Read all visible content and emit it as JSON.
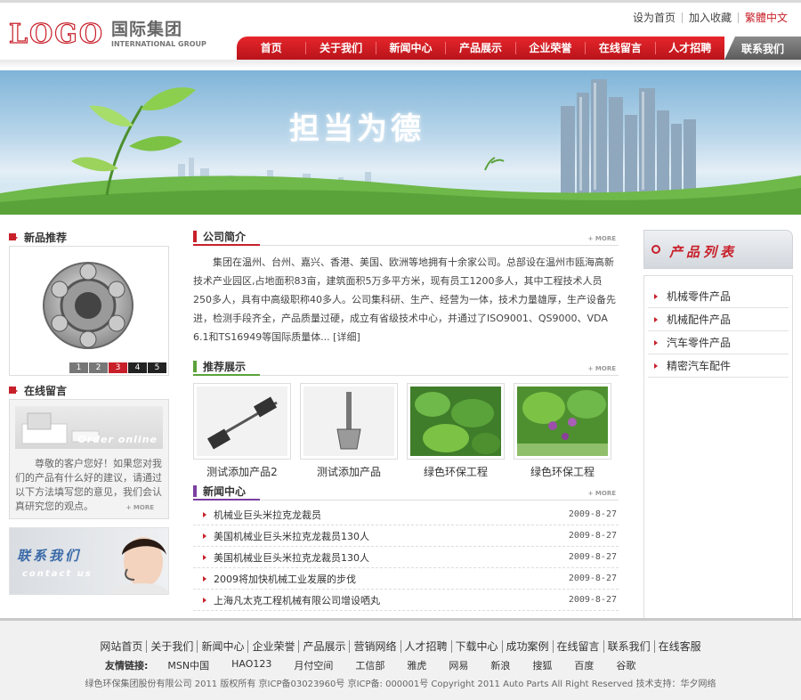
{
  "header": {
    "logo_mark": "LOGO",
    "logo_cn": "国际集团",
    "logo_en": "INTERNATIONAL GROUP",
    "top_links": [
      "设为首页",
      "加入收藏",
      "繁體中文"
    ]
  },
  "nav": {
    "items": [
      "首页",
      "关于我们",
      "新闻中心",
      "产品展示",
      "企业荣誉",
      "在线留言",
      "人才招聘"
    ],
    "contact": "联系我们"
  },
  "banner": {
    "title": "担当为德"
  },
  "left": {
    "new_products_title": "新品推荐",
    "pager": [
      "1",
      "2",
      "3",
      "4",
      "5"
    ],
    "message_title": "在线留言",
    "order_online": "Order online",
    "message_text": "尊敬的客户您好！如果您对我们的产品有什么好的建议，请通过以下方法填写您的意见，我们会认真研究您的观点。",
    "more": "+ MORE",
    "contact_cn": "联系我们",
    "contact_en": "contact us"
  },
  "main": {
    "about_title": "公司简介",
    "more": "+ MORE",
    "about_text": "集团在温州、台州、嘉兴、香港、美国、欧洲等地拥有十余家公司。总部设在温州市瓯海高新技术产业园区,占地面积83亩，建筑面积5万多平方米，现有员工1200多人，其中工程技术人员250多人，具有中高级职称40多人。公司集科研、生产、经营为一体，技术力量雄厚，生产设备先进，检测手段齐全，产品质量过硬，成立有省级技术中心，并通过了ISO9001、QS9000、VDA 6.1和TS16949等国际质量体... [详细]",
    "recommend_title": "推荐展示",
    "recommend_items": [
      "测试添加产品2",
      "测试添加产品",
      "绿色环保工程",
      "绿色环保工程"
    ],
    "news_title": "新闻中心",
    "news": [
      {
        "title": "机械业巨头米拉克龙裁员",
        "date": "2009-8-27"
      },
      {
        "title": "美国机械业巨头米拉克龙裁员130人",
        "date": "2009-8-27"
      },
      {
        "title": "美国机械业巨头米拉克龙裁员130人",
        "date": "2009-8-27"
      },
      {
        "title": "2009将加快机械工业发展的步伐",
        "date": "2009-8-27"
      },
      {
        "title": "上海凡太克工程机械有限公司增设哂丸",
        "date": "2009-8-27"
      }
    ]
  },
  "right": {
    "title": "产品列表",
    "items": [
      "机械零件产品",
      "机械配件产品",
      "汽车零件产品",
      "精密汽车配件"
    ]
  },
  "footer": {
    "links": [
      "网站首页",
      "关于我们",
      "新闻中心",
      "企业荣誉",
      "产品展示",
      "营销网络",
      "人才招聘",
      "下载中心",
      "成功案例",
      "在线留言",
      "联系我们",
      "在线客服"
    ],
    "friends_label": "友情链接:",
    "friends": [
      "MSN中国",
      "HAO123",
      "月付空间",
      "工信部",
      "雅虎",
      "网易",
      "新浪",
      "搜狐",
      "百度",
      "谷歌"
    ],
    "copyright": "绿色环保集团股份有限公司 2011 版权所有 京ICP备03023960号 京ICP备: 000001号 Copyright 2011 Auto Parts All Right Reserved 技术支持：华夕网络"
  }
}
